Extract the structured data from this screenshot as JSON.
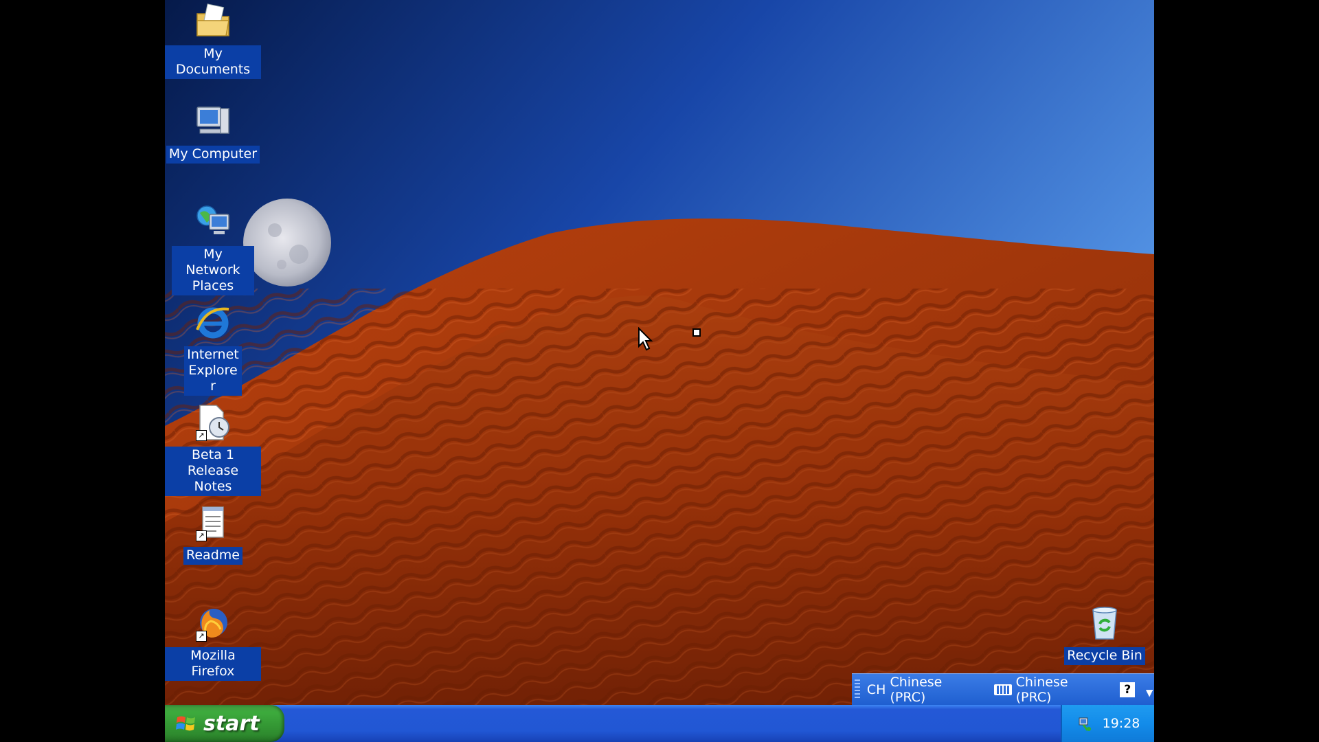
{
  "desktop": {
    "icons": [
      {
        "name": "my-documents",
        "label": "My Documents",
        "icon": "folder-documents-icon"
      },
      {
        "name": "my-computer",
        "label": "My Computer",
        "icon": "computer-icon"
      },
      {
        "name": "my-network-places",
        "label": "My Network Places",
        "icon": "network-icon"
      },
      {
        "name": "internet-explorer",
        "label": "Internet Explorer",
        "icon": "internet-explorer-icon"
      },
      {
        "name": "beta-release-notes",
        "label": "Beta 1 Release Notes",
        "icon": "release-notes-shortcut-icon"
      },
      {
        "name": "readme",
        "label": "Readme",
        "icon": "notepad-shortcut-icon"
      },
      {
        "name": "mozilla-firefox",
        "label": "Mozilla Firefox",
        "icon": "firefox-shortcut-icon"
      },
      {
        "name": "recycle-bin",
        "label": "Recycle Bin",
        "icon": "recycle-bin-icon"
      }
    ]
  },
  "langbar": {
    "input_language": "CH",
    "language_label": "Chinese (PRC)",
    "keyboard_label": "Chinese (PRC)",
    "help_label": "?"
  },
  "taskbar": {
    "start_label": "start",
    "clock": "19:28"
  },
  "colors": {
    "label_highlight": "#0b3fa6",
    "taskbar_blue": "#2157d4",
    "start_green": "#3dab3d",
    "tray_blue": "#138cea"
  }
}
